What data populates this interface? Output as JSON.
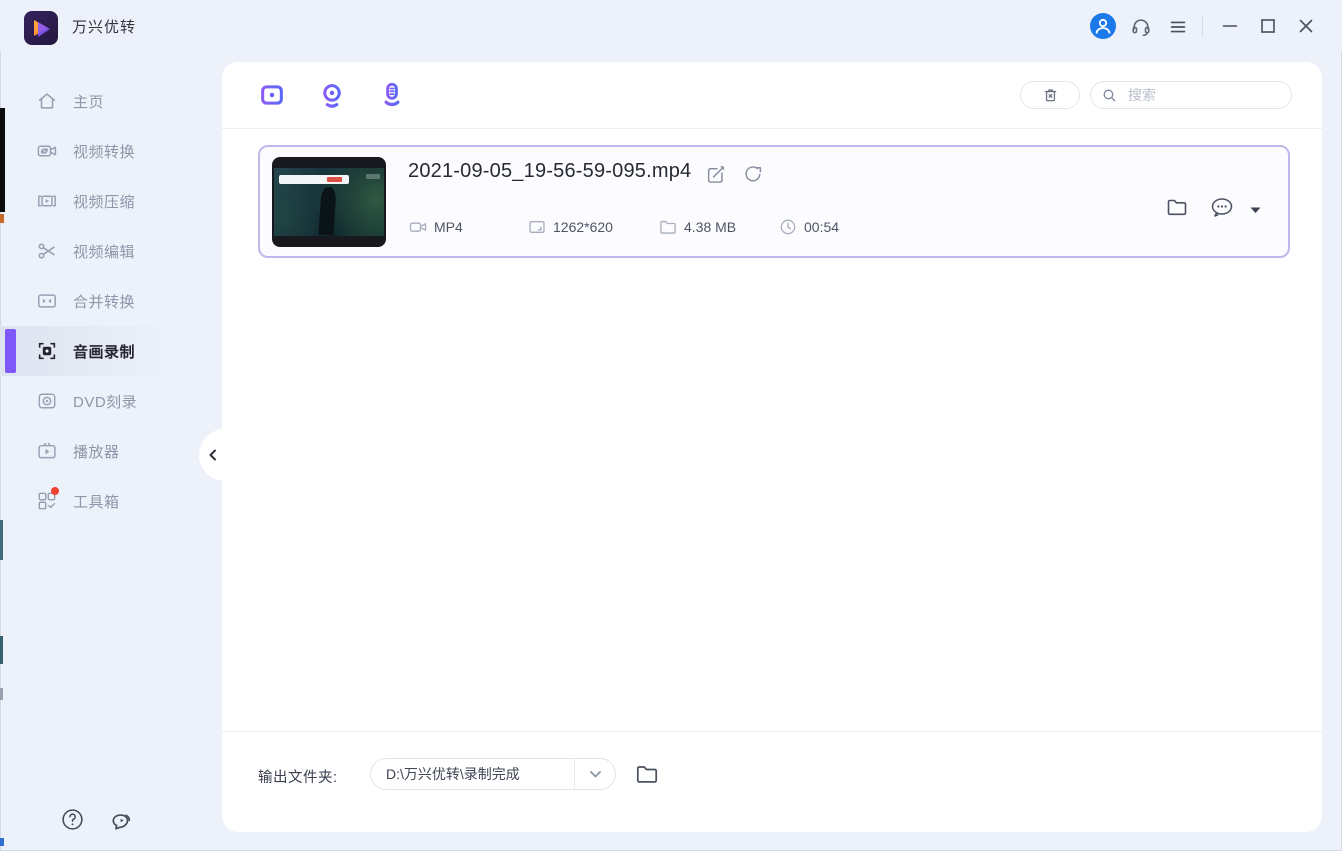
{
  "titlebar": {
    "app_title": "万兴优转"
  },
  "sidebar": {
    "items": [
      {
        "label": "主页"
      },
      {
        "label": "视频转换"
      },
      {
        "label": "视频压缩"
      },
      {
        "label": "视频编辑"
      },
      {
        "label": "合并转换"
      },
      {
        "label": "音画录制"
      },
      {
        "label": "DVD刻录"
      },
      {
        "label": "播放器"
      },
      {
        "label": "工具箱"
      }
    ]
  },
  "toolbar": {
    "search_placeholder": "搜索"
  },
  "recording_item": {
    "filename": "2021-09-05_19-56-59-095.mp4",
    "format": "MP4",
    "resolution": "1262*620",
    "size": "4.38 MB",
    "duration": "00:54"
  },
  "footer": {
    "output_label": "输出文件夹:",
    "output_path": "D:\\万兴优转\\录制完成"
  },
  "colors": {
    "accent_purple": "#7b5bf6",
    "accent_blue": "#5c67f7",
    "avatar_blue": "#1b79ea",
    "badge_red": "#f0402e",
    "card_border": "#beb8ec",
    "sidebar_bg": "#edf1f9"
  }
}
